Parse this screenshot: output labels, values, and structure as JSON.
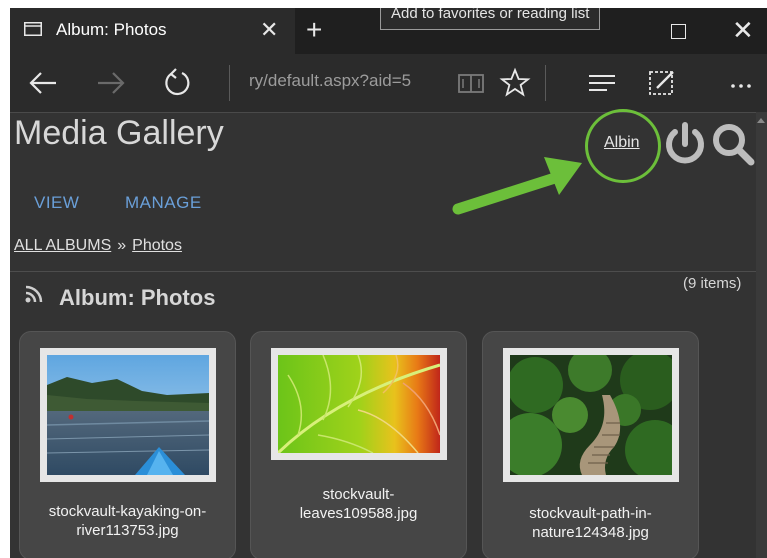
{
  "browser": {
    "tab_title": "Album: Photos",
    "tooltip": "Add to favorites or reading list",
    "address": "ry/default.aspx?aid=5"
  },
  "page": {
    "gallery_title": "Media Gallery",
    "user_name": "Albin",
    "nav": {
      "view": "VIEW",
      "manage": "MANAGE"
    },
    "breadcrumb": {
      "root": "ALL ALBUMS",
      "separator": "»",
      "current": "Photos"
    },
    "album_title": "Album: Photos",
    "item_count": "(9 items)",
    "thumbnails": [
      {
        "line1": "stockvault-kayaking-on-",
        "line2": "river113753.jpg"
      },
      {
        "line1": "stockvault-",
        "line2": "leaves109588.jpg"
      },
      {
        "line1": "stockvault-path-in-",
        "line2": "nature124348.jpg"
      }
    ]
  },
  "colors": {
    "accent_link": "#6a9fd8",
    "highlight_green": "#6cbf3a",
    "page_background": "#333333"
  }
}
